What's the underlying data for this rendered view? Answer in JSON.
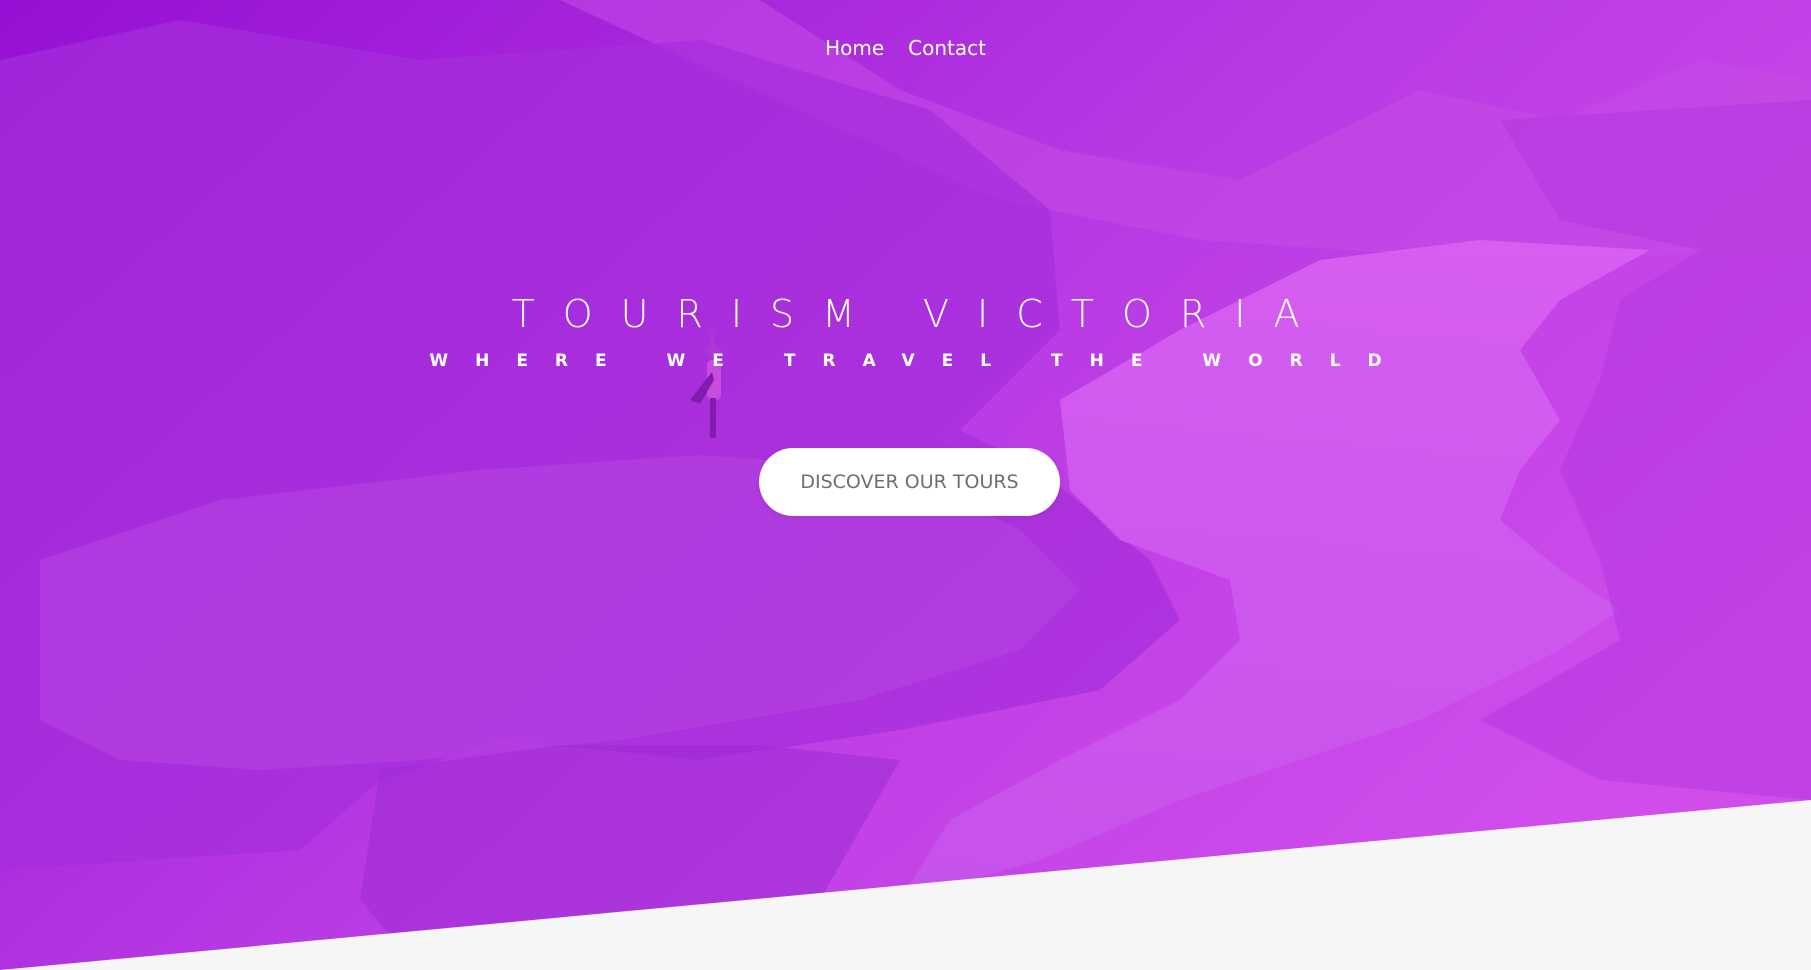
{
  "nav": {
    "items": [
      {
        "label": "Home"
      },
      {
        "label": "Contact"
      }
    ]
  },
  "hero": {
    "title": "TOURISM VICTORIA",
    "subtitle": "WHERE WE TRAVEL THE WORLD",
    "cta_label": "DISCOVER OUR TOURS"
  },
  "colors": {
    "overlay_start": "#9a14d6",
    "overlay_end": "#cf4ded",
    "section_bg": "#f6f6f6",
    "button_bg": "#ffffff",
    "button_text": "#6f6f6f"
  }
}
